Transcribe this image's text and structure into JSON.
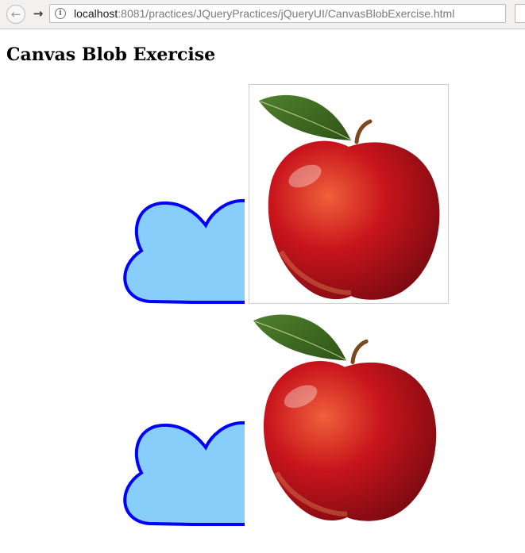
{
  "browser": {
    "back_icon": "arrow-left-icon",
    "forward_icon": "arrow-right-icon",
    "info_icon": "info-icon",
    "info_glyph": "i",
    "url_host": "localhost",
    "url_path": ":8081/practices/JQueryPractices/jQueryUI/CanvasBlobExercise.html"
  },
  "page": {
    "title": "Canvas Blob Exercise"
  },
  "colors": {
    "cloud_fill": "#87CEFA",
    "cloud_stroke": "#0000FF",
    "apple_red": "#c0141c",
    "leaf_green": "#3e6b22"
  }
}
